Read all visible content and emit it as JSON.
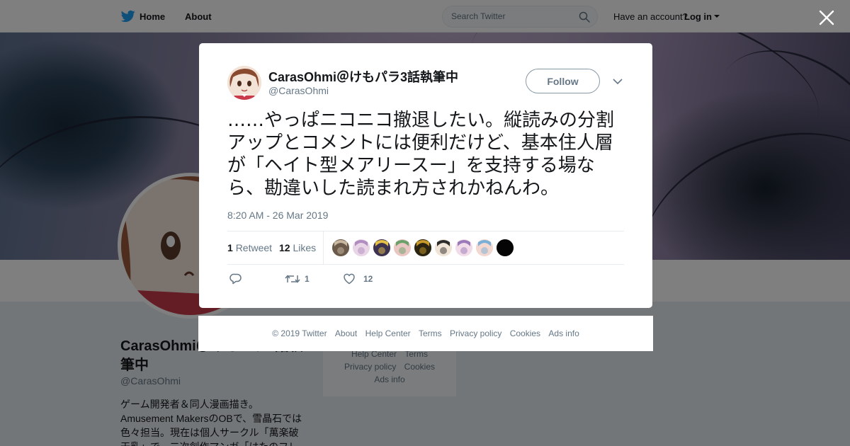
{
  "header": {
    "home": "Home",
    "about": "About",
    "search_placeholder": "Search Twitter",
    "account_prompt": "Have an account?",
    "login": "Log in"
  },
  "profile": {
    "name": "CarasOhmi＠けもパラ3話執筆中",
    "handle": "@CarasOhmi",
    "bio": "ゲーム開発者＆同人漫画描き。Amusement MakersのOBで、雪晶石では色々担当。現在は個人サークル「萬楽破天乳」で、二次創作マンガ「はたのフレ"
  },
  "background_footer": {
    "links_row1": [
      "Help Center",
      "Terms"
    ],
    "links_row2": [
      "Privacy policy",
      "Cookies"
    ],
    "links_row3": [
      "Ads info"
    ]
  },
  "tweet": {
    "author_name": "CarasOhmi＠けもパラ3話執筆中",
    "author_handle": "@CarasOhmi",
    "follow_label": "Follow",
    "text": "……やっぱニコニコ撤退したい。縦読みの分割アップとコメントには便利だけど、基本住人層が「ヘイト型メアリースー」を支持する場なら、勘違いした読まれ方されかねんわ。",
    "timestamp": "8:20 AM - 26 Mar 2019",
    "retweet_count": "1",
    "retweet_label": "Retweet",
    "like_count": "12",
    "like_label": "Likes",
    "action_retweet_count": "1",
    "action_like_count": "12",
    "likers": [
      {
        "color": "#6b5a4a",
        "accent": "#c9b8a0"
      },
      {
        "color": "#e8d6e6",
        "accent": "#b08cc0"
      },
      {
        "color": "#3d3350",
        "accent": "#e6c14a"
      },
      {
        "color": "#e9c6c2",
        "accent": "#6aa06a"
      },
      {
        "color": "#2a2410",
        "accent": "#c89a2a"
      },
      {
        "color": "#f0e4d6",
        "accent": "#2b2b2b"
      },
      {
        "color": "#f3dcea",
        "accent": "#9a7ab8"
      },
      {
        "color": "#f2d8d0",
        "accent": "#7ab0d8"
      },
      {
        "color": "#050505",
        "accent": "#050505"
      }
    ]
  },
  "footer": {
    "links": [
      "© 2019 Twitter",
      "About",
      "Help Center",
      "Terms",
      "Privacy policy",
      "Cookies",
      "Ads info"
    ]
  },
  "colors": {
    "brand": "#1da1f2",
    "text": "#14171a",
    "muted": "#657786"
  }
}
